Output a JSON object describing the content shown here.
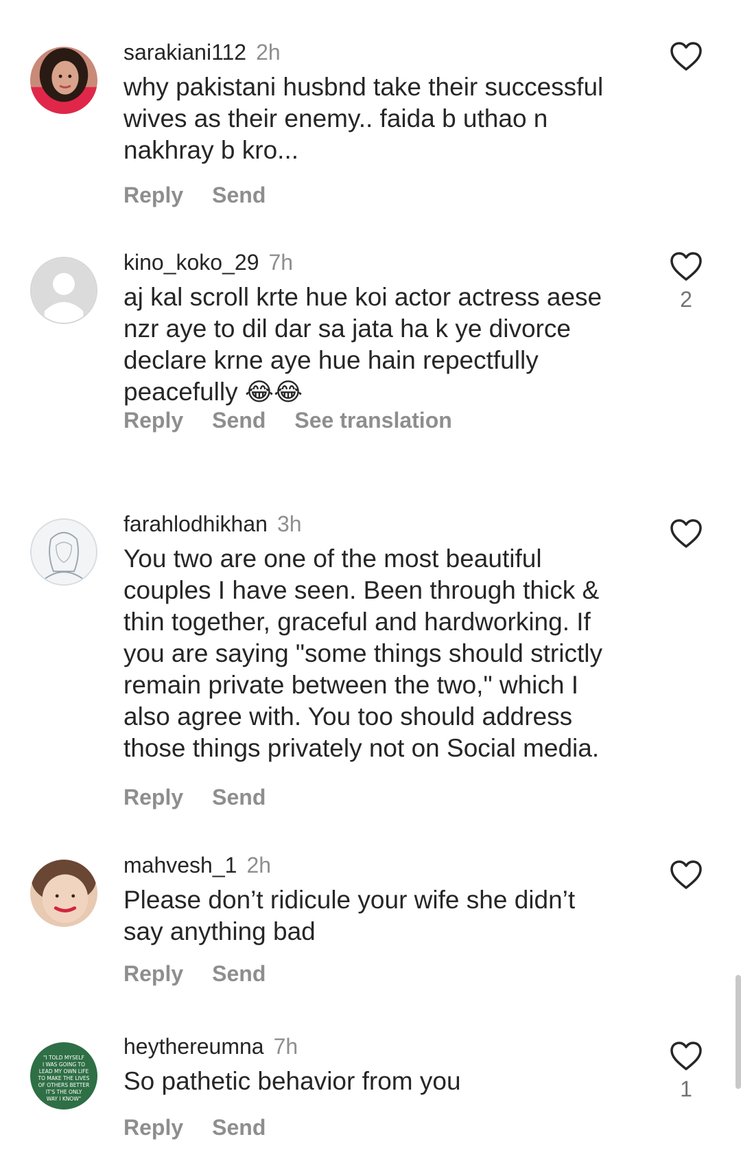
{
  "actions": {
    "reply": "Reply",
    "send": "Send",
    "see_translation": "See translation"
  },
  "comments": [
    {
      "username": "sarakiani112",
      "time": "2h",
      "lines": [
        "why pakistani husbnd take their successful",
        "wives as their enemy.. faida b uthao n",
        "nakhray b kro..."
      ],
      "likes": ""
    },
    {
      "username": "kino_koko_29",
      "time": "7h",
      "lines": [
        "aj kal scroll krte hue koi actor actress aese",
        "nzr aye to dil dar sa jata ha k ye divorce",
        "declare krne aye hue hain repectfully",
        "peacefully"
      ],
      "emoji": "😂😂",
      "likes": "2"
    },
    {
      "username": "farahlodhikhan",
      "time": "3h",
      "lines": [
        "You two are one of the most beautiful",
        "couples I have seen. Been through thick &",
        "thin together, graceful and hardworking. If",
        "you are saying \"some things should strictly",
        "remain private between the two,\" which I",
        "also agree with. You too should address",
        "those things privately not on Social media."
      ],
      "likes": ""
    },
    {
      "username": "mahvesh_1",
      "time": "2h",
      "lines": [
        "Please don’t ridicule your wife she didn’t",
        "say anything bad"
      ],
      "likes": ""
    },
    {
      "username": "heythereumna",
      "time": "7h",
      "lines": [
        "So pathetic behavior from you"
      ],
      "likes": "1",
      "avatar_text": [
        "\"I TOLD MYSELF",
        "I WAS GOING TO",
        "LEAD MY OWN LIFE",
        "TO MAKE THE LIVES",
        "OF OTHERS BETTER",
        "IT'S THE ONLY",
        "WAY I KNOW\""
      ]
    }
  ],
  "colors": {
    "text": "#262626",
    "muted": "#8e8e8e",
    "like_outline": "#262626"
  }
}
